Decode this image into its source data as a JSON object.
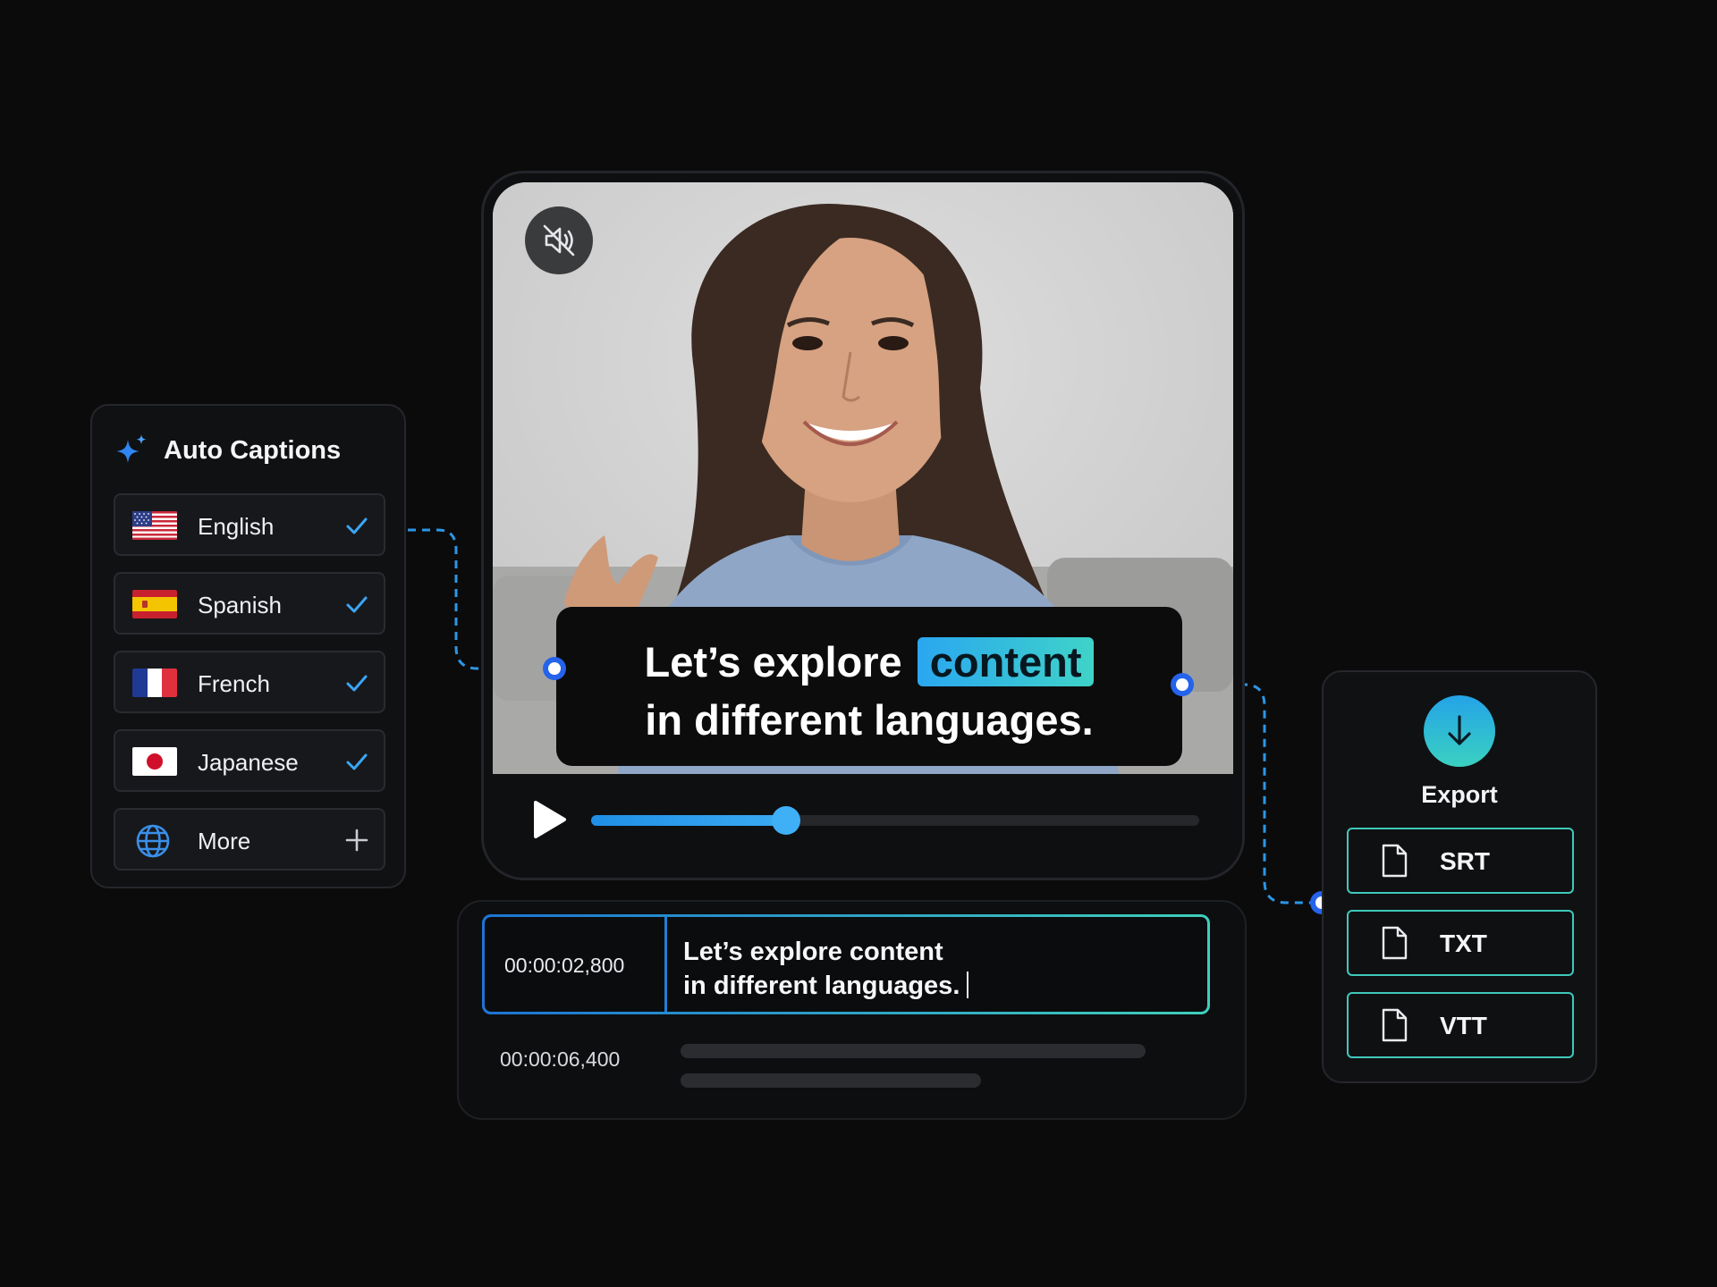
{
  "colors": {
    "background": "#0b0b0c",
    "accent_blue": "#2aa7f0",
    "accent_teal": "#3fd3c8",
    "panel": "#101113"
  },
  "captions_panel": {
    "title": "Auto Captions",
    "icon": "sparkle-icon",
    "languages": [
      {
        "label": "English",
        "flag": "us-flag-icon",
        "selected": true
      },
      {
        "label": "Spanish",
        "flag": "spain-flag-icon",
        "selected": true
      },
      {
        "label": "French",
        "flag": "france-flag-icon",
        "selected": true
      },
      {
        "label": "Japanese",
        "flag": "japan-flag-icon",
        "selected": true
      }
    ],
    "more": {
      "label": "More",
      "icon": "globe-icon",
      "action_icon": "plus-icon"
    }
  },
  "player": {
    "mute_icon": "muted-speaker-icon",
    "caption": {
      "line1_before": "Let’s explore",
      "line1_highlight": "content",
      "line2": "in different languages."
    },
    "play_icon": "play-icon",
    "progress": 0.32
  },
  "timeline": {
    "segments": [
      {
        "time": "00:00:02,800",
        "text_line1": "Let’s explore content",
        "text_line2": "in different languages."
      },
      {
        "time": "00:00:06,400"
      }
    ]
  },
  "export_panel": {
    "icon": "download-icon",
    "label": "Export",
    "formats": [
      {
        "label": "SRT",
        "icon": "file-icon"
      },
      {
        "label": "TXT",
        "icon": "file-icon"
      },
      {
        "label": "VTT",
        "icon": "file-icon"
      }
    ]
  }
}
